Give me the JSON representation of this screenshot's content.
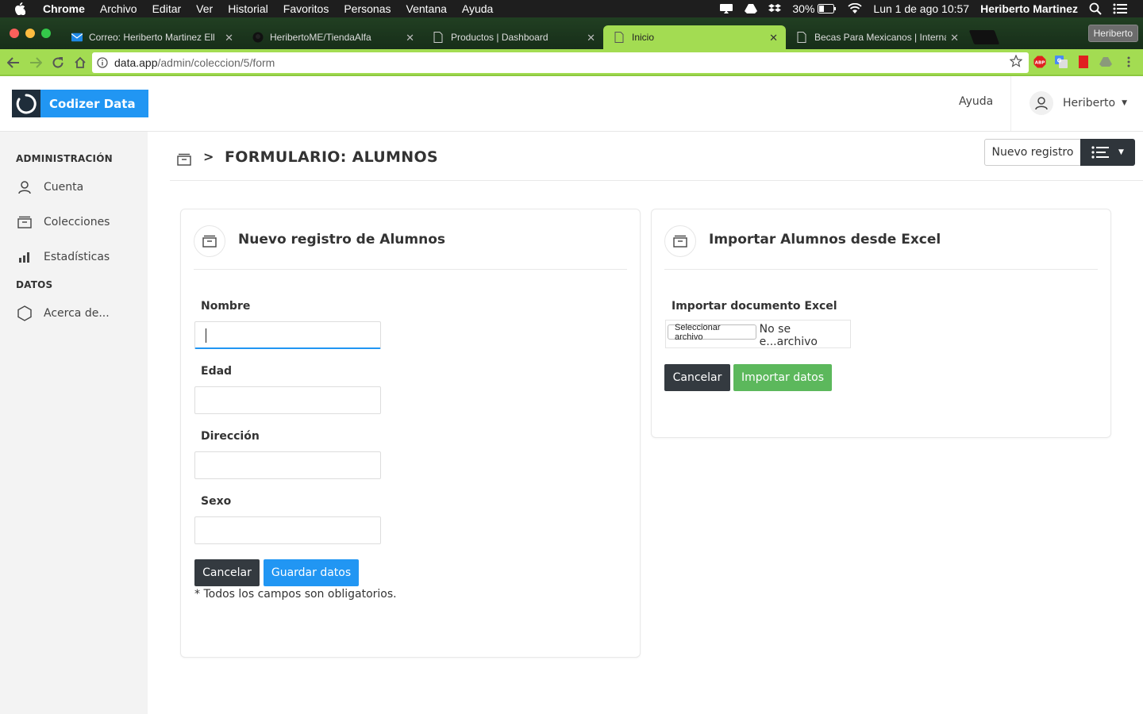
{
  "os_menu": {
    "app": "Chrome",
    "items": [
      "Archivo",
      "Editar",
      "Ver",
      "Historial",
      "Favoritos",
      "Personas",
      "Ventana",
      "Ayuda"
    ],
    "battery": "30%",
    "clock": "Lun 1 de ago  10:57",
    "user": "Heriberto Martinez"
  },
  "browser": {
    "tabs": [
      {
        "title": "Correo: Heriberto Martinez Ell",
        "icon": "mail-icon"
      },
      {
        "title": "HeribertoME/TiendaAlfa",
        "icon": "github-icon"
      },
      {
        "title": "Productos | Dashboard",
        "icon": "page-icon"
      },
      {
        "title": "Inicio",
        "icon": "page-icon",
        "active": true
      },
      {
        "title": "Becas Para Mexicanos | Interna",
        "icon": "page-icon"
      }
    ],
    "profile": "Heriberto",
    "url_host": "data.app",
    "url_path": "/admin/coleccion/5/form",
    "theme_color": "#a3dc52"
  },
  "header": {
    "brand": "Codizer Data",
    "help": "Ayuda",
    "user": "Heriberto"
  },
  "sidebar": {
    "section_admin": "ADMINISTRACIÓN",
    "section_data": "DATOS",
    "items": [
      {
        "label": "Cuenta",
        "icon": "user-icon"
      },
      {
        "label": "Colecciones",
        "icon": "archive-icon"
      },
      {
        "label": "Estadísticas",
        "icon": "bar-chart-icon"
      },
      {
        "label": "Acerca de...",
        "icon": "hexagon-icon"
      }
    ]
  },
  "page": {
    "separator": ">",
    "title": "FORMULARIO: ALUMNOS",
    "new_record": "Nuevo registro"
  },
  "form_card": {
    "title": "Nuevo registro de Alumnos",
    "fields": [
      {
        "label": "Nombre",
        "value": ""
      },
      {
        "label": "Edad",
        "value": ""
      },
      {
        "label": "Dirección",
        "value": ""
      },
      {
        "label": "Sexo",
        "value": ""
      }
    ],
    "cancel": "Cancelar",
    "save": "Guardar datos",
    "note": "* Todos los campos son obligatorios."
  },
  "import_card": {
    "title": "Importar Alumnos desde Excel",
    "label": "Importar documento Excel",
    "file_button": "Seleccionar archivo",
    "file_status": "No se e...archivo",
    "cancel": "Cancelar",
    "import": "Importar datos"
  },
  "colors": {
    "primary": "#2196f3",
    "dark": "#343a40",
    "success": "#5cb85c",
    "sidebar_bg": "#f3f3f3"
  }
}
